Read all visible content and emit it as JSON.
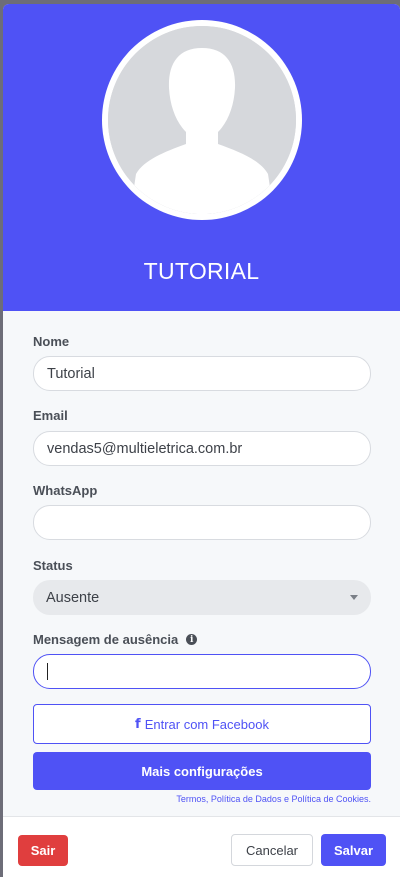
{
  "profile": {
    "name": "TUTORIAL"
  },
  "form": {
    "nome": {
      "label": "Nome",
      "value": "Tutorial"
    },
    "email": {
      "label": "Email",
      "value": "vendas5@multieletrica.com.br"
    },
    "whatsapp": {
      "label": "WhatsApp",
      "value": ""
    },
    "status": {
      "label": "Status",
      "value": "Ausente"
    },
    "away_message": {
      "label": "Mensagem de ausência",
      "value": "",
      "info_icon": "info-circle-icon"
    }
  },
  "actions": {
    "facebook_label": "Entrar com Facebook",
    "facebook_icon": "f",
    "more_settings_label": "Mais configurações",
    "terms_text": "Termos, Política de Dados e Política de Cookies."
  },
  "footer": {
    "logout_label": "Sair",
    "cancel_label": "Cancelar",
    "save_label": "Salvar"
  },
  "colors": {
    "accent": "#4f52f5",
    "danger": "#e03e3e",
    "avatar_placeholder": "#d6d8dc"
  }
}
